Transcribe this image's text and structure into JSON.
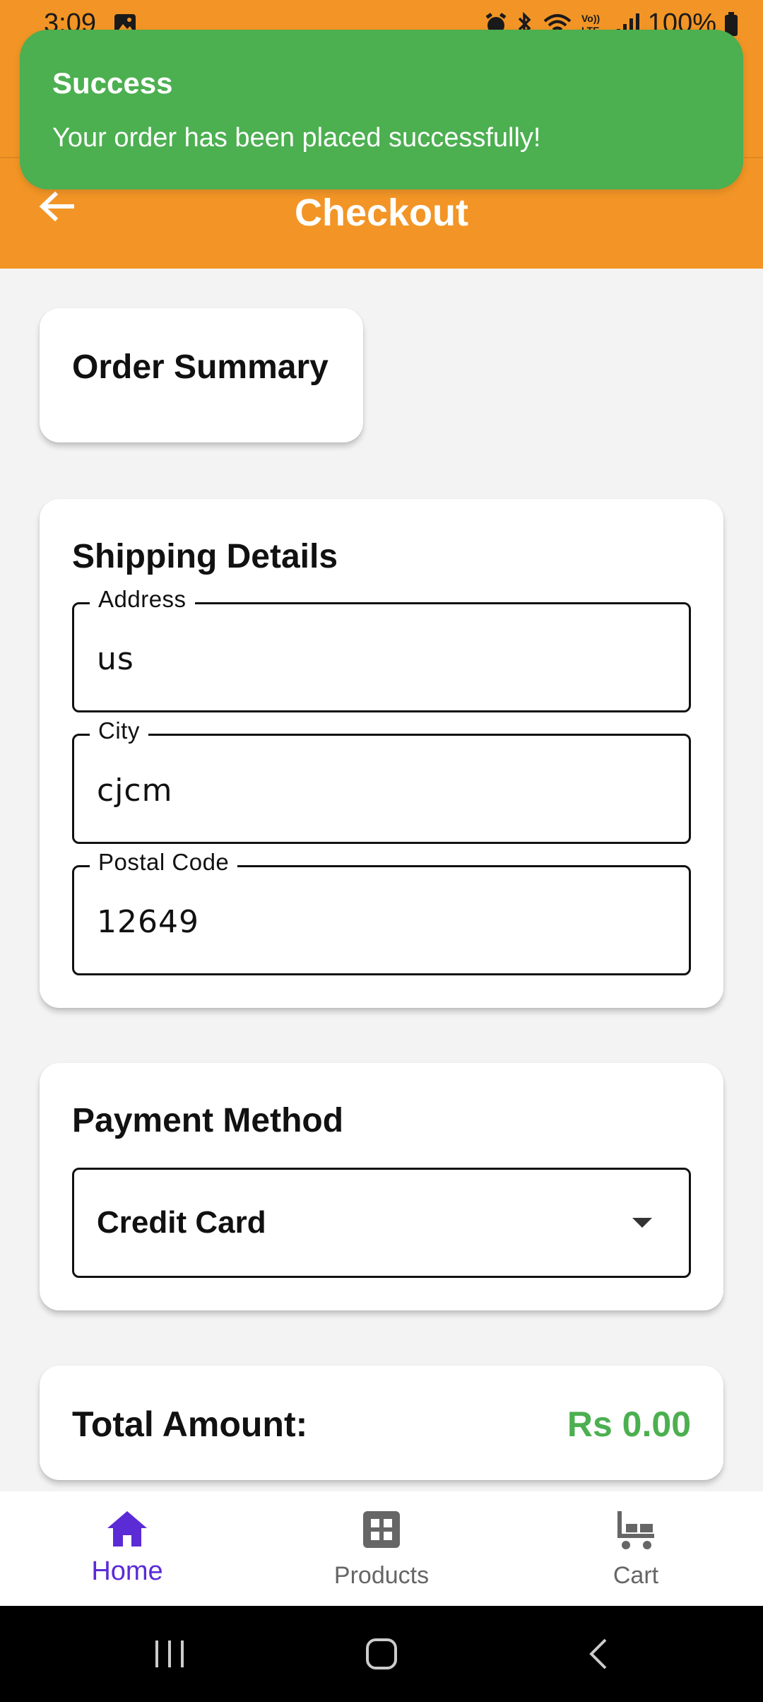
{
  "status_bar": {
    "time": "3:09",
    "battery": "100%"
  },
  "appbar": {
    "title": "Checkout"
  },
  "snackbar": {
    "title": "Success",
    "message": "Your order has been placed successfully!"
  },
  "order_summary": {
    "heading": "Order Summary"
  },
  "shipping": {
    "heading": "Shipping Details",
    "address_label": "Address",
    "address_value": "us",
    "city_label": "City",
    "city_value": "cjcm",
    "postal_label": "Postal Code",
    "postal_value": "12649"
  },
  "payment": {
    "heading": "Payment Method",
    "selected": "Credit Card"
  },
  "total": {
    "label": "Total Amount:",
    "value": "Rs 0.00"
  },
  "bottom_nav": {
    "home": "Home",
    "products": "Products",
    "cart": "Cart"
  },
  "colors": {
    "appbar": "#F29526",
    "success": "#4CAF50",
    "nav_active": "#5B2BD6"
  }
}
